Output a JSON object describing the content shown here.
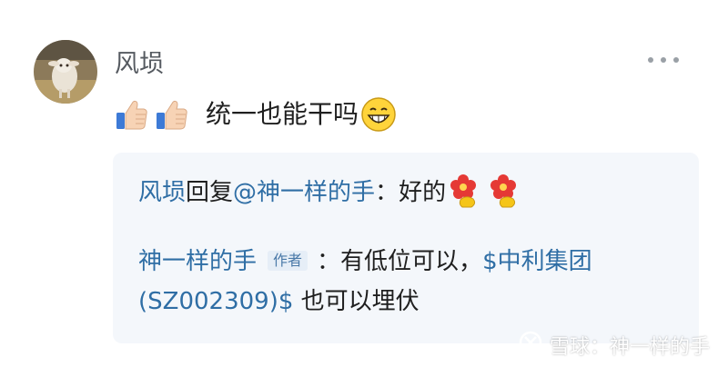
{
  "comment": {
    "author": "风埙",
    "text": "统一也能干吗",
    "reactions_before": [
      "thumbs-up-icon",
      "thumbs-up-icon"
    ],
    "reaction_after": "grinning-face-icon"
  },
  "reply": {
    "author": "风埙",
    "action": " 回复",
    "mention": "@神一样的手",
    "colon": "：",
    "text": "好的",
    "emojis": [
      "flower-icon",
      "flower-icon"
    ]
  },
  "original": {
    "author": "神一样的手",
    "badge": "作者",
    "colon": "：",
    "text_before": "有低位可以，",
    "stock_link": "$中利集团(SZ002309)$",
    "text_after": " 也可以埋伏"
  },
  "watermark": {
    "text": "雪球：神一样的手"
  },
  "colors": {
    "link": "#2f6ea5",
    "quote_bg": "#f4f7fb",
    "username": "#555a60"
  }
}
